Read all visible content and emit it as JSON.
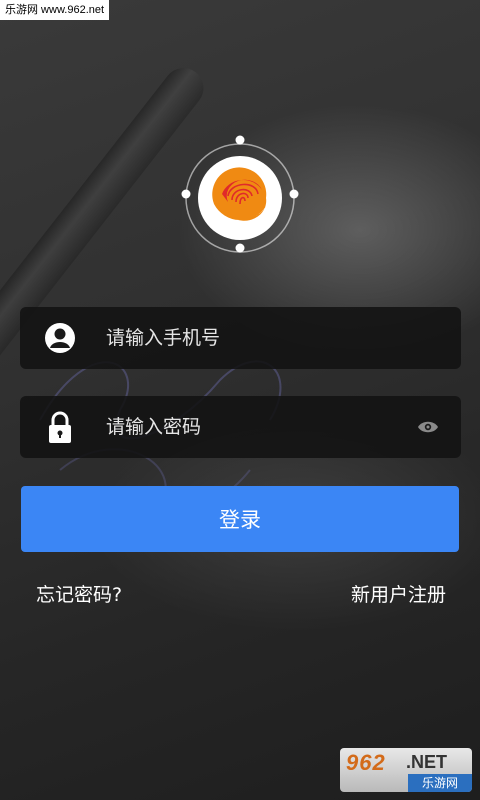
{
  "watermark": {
    "text": "乐游网 www.962.net"
  },
  "form": {
    "phone_placeholder": "请输入手机号",
    "password_placeholder": "请输入密码",
    "login_label": "登录"
  },
  "links": {
    "forgot": "忘记密码?",
    "register": "新用户注册"
  },
  "corner_badge": {
    "number": "962",
    "suffix": ".NET",
    "site_name": "乐游网"
  },
  "colors": {
    "primary_button": "#3b86f5",
    "logo_ring": "#ffffff",
    "logo_orange": "#f08a12",
    "logo_red": "#e02a2a"
  },
  "icons": {
    "user": "user-avatar-icon",
    "lock": "lock-icon",
    "eye": "eye-icon",
    "logo": "fingerprint-logo"
  }
}
